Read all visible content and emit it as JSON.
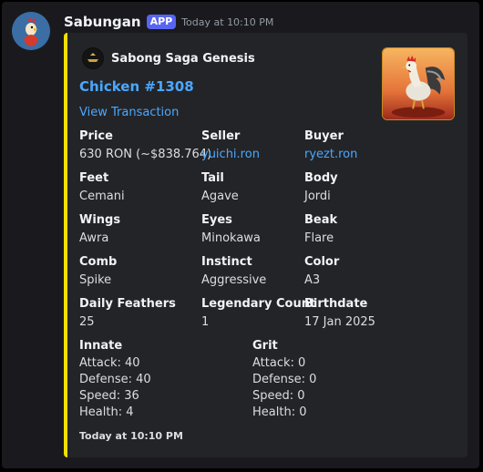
{
  "message": {
    "username": "Sabungan",
    "badge": "APP",
    "timestamp": "Today at 10:10 PM"
  },
  "embed": {
    "accent_color": "#f0e000",
    "author": {
      "name": "Sabong Saga Genesis",
      "icon": "sabong-saga-logo"
    },
    "title": "Chicken #1308",
    "link_label": "View Transaction",
    "thumbnail": "rooster-image",
    "fields": [
      {
        "name": "Price",
        "value": "630 RON (~$838.764)",
        "link": false
      },
      {
        "name": "Seller",
        "value": "yuichi.ron",
        "link": true
      },
      {
        "name": "Buyer",
        "value": "ryezt.ron",
        "link": true
      },
      {
        "name": "Feet",
        "value": "Cemani",
        "link": false
      },
      {
        "name": "Tail",
        "value": "Agave",
        "link": false
      },
      {
        "name": "Body",
        "value": "Jordi",
        "link": false
      },
      {
        "name": "Wings",
        "value": "Awra",
        "link": false
      },
      {
        "name": "Eyes",
        "value": "Minokawa",
        "link": false
      },
      {
        "name": "Beak",
        "value": "Flare",
        "link": false
      },
      {
        "name": "Comb",
        "value": "Spike",
        "link": false
      },
      {
        "name": "Instinct",
        "value": "Aggressive",
        "link": false
      },
      {
        "name": "Color",
        "value": "A3",
        "link": false
      },
      {
        "name": "Daily Feathers",
        "value": "25",
        "link": false
      },
      {
        "name": "Legendary Count",
        "value": "1",
        "link": false
      },
      {
        "name": "Birthdate",
        "value": "17 Jan 2025",
        "link": false
      }
    ],
    "innate": {
      "name": "Innate",
      "stats": [
        "Attack: 40",
        "Defense: 40",
        "Speed: 36",
        "Health: 4"
      ]
    },
    "grit": {
      "name": "Grit",
      "stats": [
        "Attack: 0",
        "Defense: 0",
        "Speed: 0",
        "Health: 0"
      ]
    },
    "footer": "Today at 10:10 PM"
  }
}
